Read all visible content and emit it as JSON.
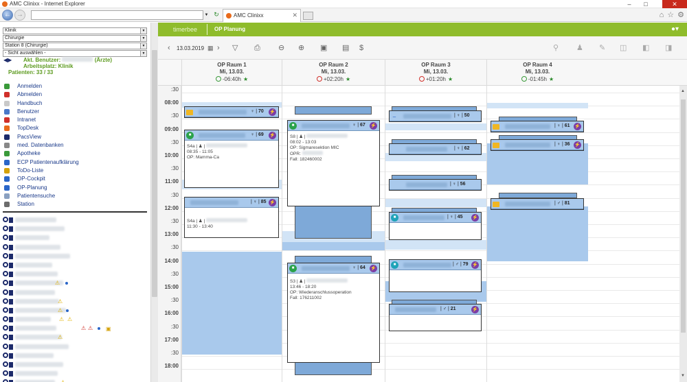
{
  "window": {
    "title": "AMC Clinixx - Internet Explorer",
    "tab_label": "AMC Clinixx"
  },
  "selects": {
    "s1": "Klinik",
    "s2": "Chirurgie",
    "s3": "Station 8 (Chirurgie)",
    "s4": "- Sicht auswählen -"
  },
  "user": {
    "akt_label": "Akt. Benutzer:",
    "role": "(Ärzte)",
    "workplace": "Arbeitsplatz: Klinik",
    "patients": "Patienten: 33 / 33"
  },
  "menu": [
    {
      "label": "Anmelden",
      "color": "#3a9a3a"
    },
    {
      "label": "Abmelden",
      "color": "#d0302a"
    },
    {
      "label": "Handbuch",
      "color": "#c9c9c9"
    },
    {
      "label": "Benutzer",
      "color": "#4a78c8"
    },
    {
      "label": "Intranet",
      "color": "#d0302a"
    },
    {
      "label": "TopDesk",
      "color": "#e86a1b"
    },
    {
      "label": "PacsView",
      "color": "#1c2a6a"
    },
    {
      "label": "med. Datenbanken",
      "color": "#888888"
    },
    {
      "label": "Apotheke",
      "color": "#3a9a3a"
    },
    {
      "label": "ECP Patientenaufklärung",
      "color": "#2a66c8"
    },
    {
      "label": "ToDo-Liste",
      "color": "#d4a20a"
    },
    {
      "label": "OP-Cockpit",
      "color": "#2a66c8"
    },
    {
      "label": "OP-Planung",
      "color": "#2a66c8"
    },
    {
      "label": "Patientensuche",
      "color": "#8aa0c0"
    },
    {
      "label": "Station",
      "color": "#6c6c6c"
    }
  ],
  "app": {
    "logo": "timerbee",
    "module": "OP Planung",
    "date": "13.03.2019"
  },
  "rooms": [
    {
      "name": "OP Raum 1",
      "day": "Mi, 13.03.",
      "time": "-06:40h"
    },
    {
      "name": "OP Raum 2",
      "day": "Mi, 13.03.",
      "time": "+02:20h"
    },
    {
      "name": "OP Raum 3",
      "day": "Mi, 13.03.",
      "time": "+01:20h"
    },
    {
      "name": "OP Raum 4",
      "day": "Mi, 13.03.",
      "time": "-01:45h"
    }
  ],
  "times": [
    ":30",
    "08:00",
    ":30",
    "09:00",
    ":30",
    "10:00",
    ":30",
    "11:00",
    ":30",
    "12:00",
    ":30",
    "13:00",
    ":30",
    "14:00",
    ":30",
    "15:00",
    ":30",
    "16:00",
    ":30",
    "17:00",
    ":30",
    "18:00"
  ],
  "cards": {
    "r1a": {
      "num": "70"
    },
    "r1b": {
      "num": "69",
      "l1": "S4a |",
      "l2": "08:35 - 11:05",
      "l3": "OP: Mamma-Ca"
    },
    "r1c": {
      "num": "85",
      "l1": "S4a |",
      "l2": "11:30 - 13:40"
    },
    "r2a": {
      "num": "67",
      "l1": "S8 |",
      "l2": "08:02 - 13:03",
      "l3": "OP: Sigmaresektion MIC",
      "l4": "OPR:",
      "l5": "Fall: 182460002"
    },
    "r2b": {
      "num": "64",
      "l1": "S3 |",
      "l2": "13:46 - 18:20",
      "l3": "OP: Wiederanschlussoperation",
      "l4": "Fall: 176211002"
    },
    "r3a": {
      "num": "50"
    },
    "r3b": {
      "num": "62"
    },
    "r3c": {
      "num": "56"
    },
    "r3d": {
      "num": "45"
    },
    "r3e": {
      "num": "79"
    },
    "r3f": {
      "num": "21"
    },
    "r4a": {
      "num": "61"
    },
    "r4b": {
      "num": "36"
    },
    "r4c": {
      "num": "81"
    }
  },
  "colors": {
    "brand_green": "#8fbc2c",
    "slot_blue": "#a9c9ec",
    "bolt_purple": "#7b3ea6"
  }
}
